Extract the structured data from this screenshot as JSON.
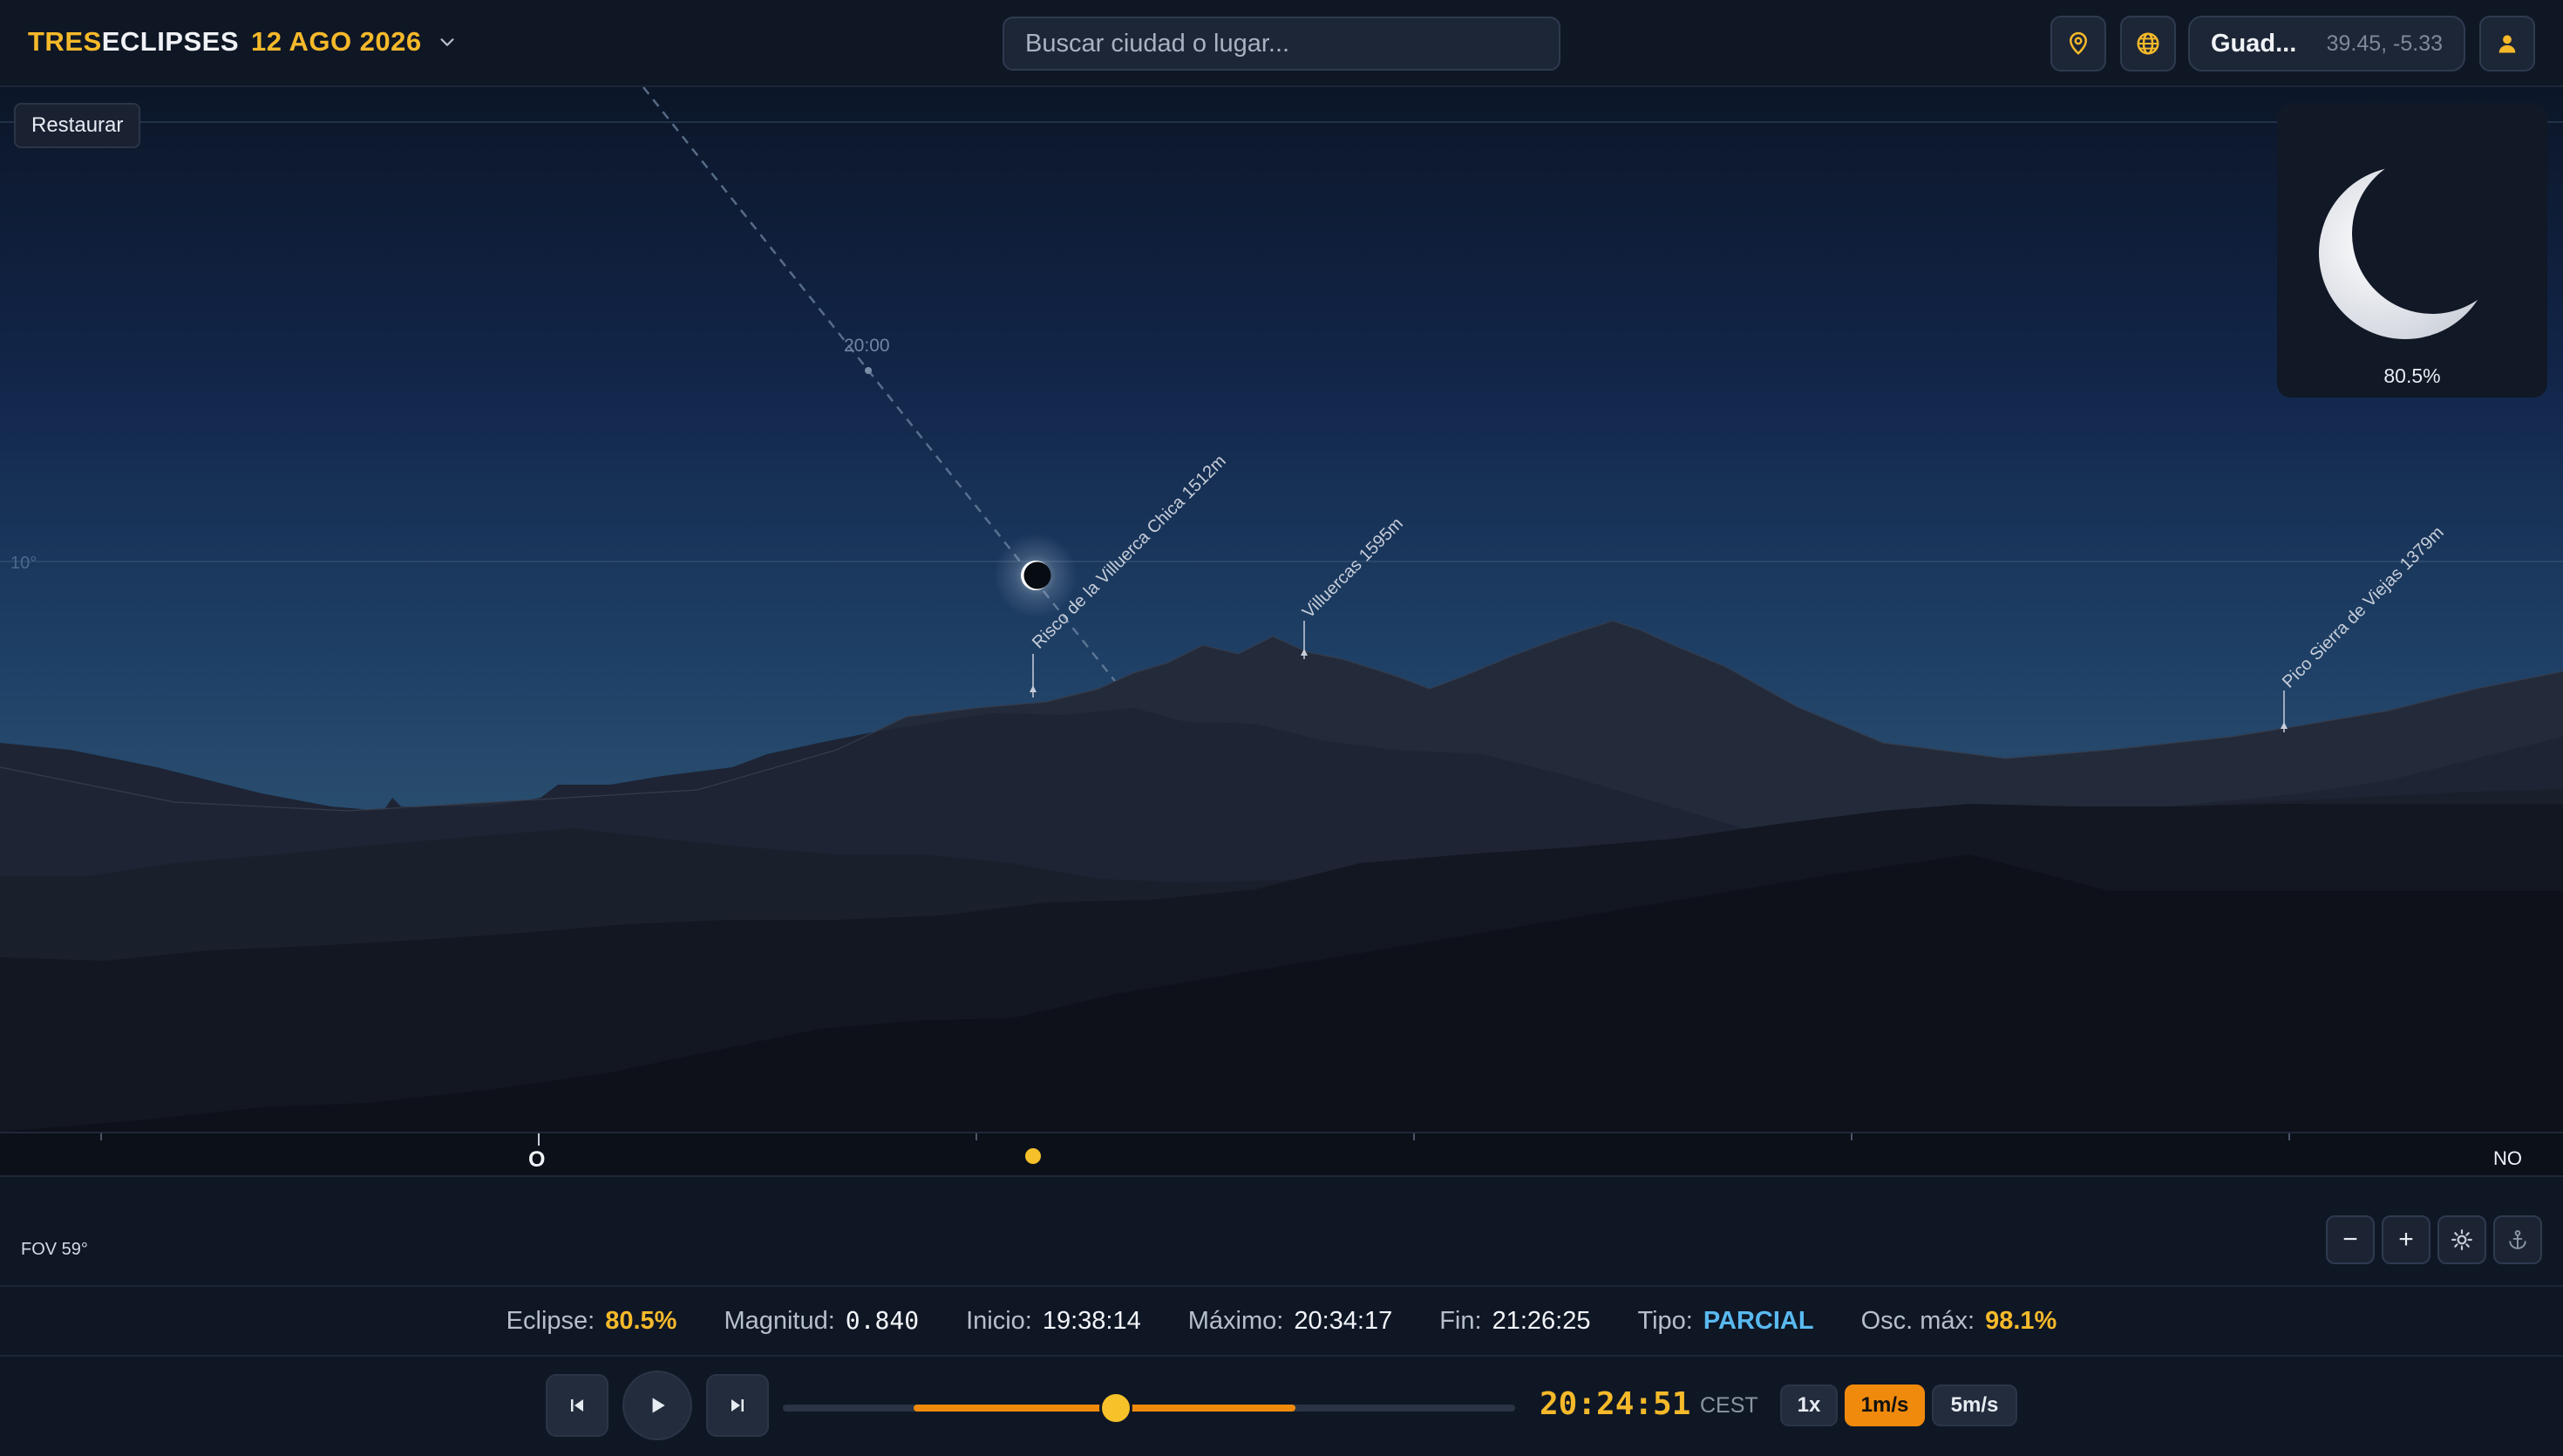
{
  "header": {
    "brand_prefix": "TRES",
    "brand_suffix": "ECLIPSES",
    "date": "12 AGO 2026",
    "search_placeholder": "Buscar ciudad o lugar...",
    "location_name": "Guad...",
    "location_coords": "39.45, -5.33"
  },
  "view": {
    "restore_label": "Restaurar",
    "time_marker": "20:00",
    "altitude_label": "10°",
    "peaks": [
      {
        "label": "Risco de la Villuerca Chica 1512m"
      },
      {
        "label": "Villuercas 1595m"
      },
      {
        "label": "Pico Sierra de Viejas 1379m"
      }
    ],
    "compass": {
      "west": "O",
      "northwest": "NO"
    },
    "fov_label": "FOV 59°",
    "eclipse_inset_percent": "80.5%"
  },
  "stats": {
    "eclipse_label": "Eclipse:",
    "eclipse_value": "80.5%",
    "magnitude_label": "Magnitud:",
    "magnitude_value": "0.840",
    "start_label": "Inicio:",
    "start_value": "19:38:14",
    "max_label": "Máximo:",
    "max_value": "20:34:17",
    "end_label": "Fin:",
    "end_value": "21:26:25",
    "type_label": "Tipo:",
    "type_value": "PARCIAL",
    "osc_label": "Osc. máx:",
    "osc_value": "98.1%"
  },
  "player": {
    "time": "20:24:51",
    "timezone": "CEST",
    "speeds": [
      "1x",
      "1m/s",
      "5m/s"
    ],
    "active_speed": "1m/s",
    "timeline_progress": 0.455
  },
  "icons": {
    "dropdown": "chevron-down-icon",
    "pin": "map-pin-icon",
    "globe": "globe-icon",
    "user": "user-icon",
    "zoom_out": "minus-icon",
    "zoom_in": "plus-icon",
    "brightness": "sun-icon",
    "anchor": "anchor-icon",
    "prev": "skip-back-icon",
    "play": "play-icon",
    "next": "skip-forward-icon"
  },
  "colors": {
    "accent": "#f5b92a",
    "active_speed": "#f08a0c",
    "type_value": "#59b9f0"
  }
}
